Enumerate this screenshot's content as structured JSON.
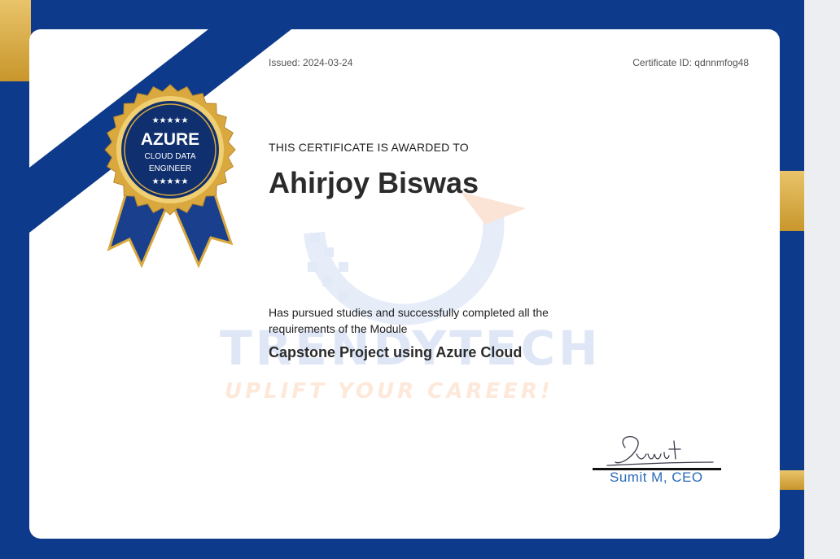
{
  "certificate": {
    "issued": "Issued: 2024-03-24",
    "certificate_id": "Certificate ID: qdnnmfog48",
    "awarded_to": "THIS CERTIFICATE IS AWARDED TO",
    "recipient": "Ahirjoy Biswas",
    "description": "Has pursued studies and successfully completed all the requirements of the Module",
    "module": "Capstone Project using Azure Cloud",
    "signature_script": "Sumit",
    "signer": "Sumit M, CEO"
  },
  "badge": {
    "stars": "★★★★★",
    "title": "AZURE",
    "line1": "CLOUD DATA",
    "line2": "ENGINEER"
  },
  "watermark": {
    "brand": "TRENDYTECH",
    "tagline": "UPLIFT YOUR CAREER!"
  },
  "colors": {
    "frame_blue": "#0d3a8a",
    "gold": "#d9a93f",
    "signer_blue": "#2a6bb8"
  }
}
